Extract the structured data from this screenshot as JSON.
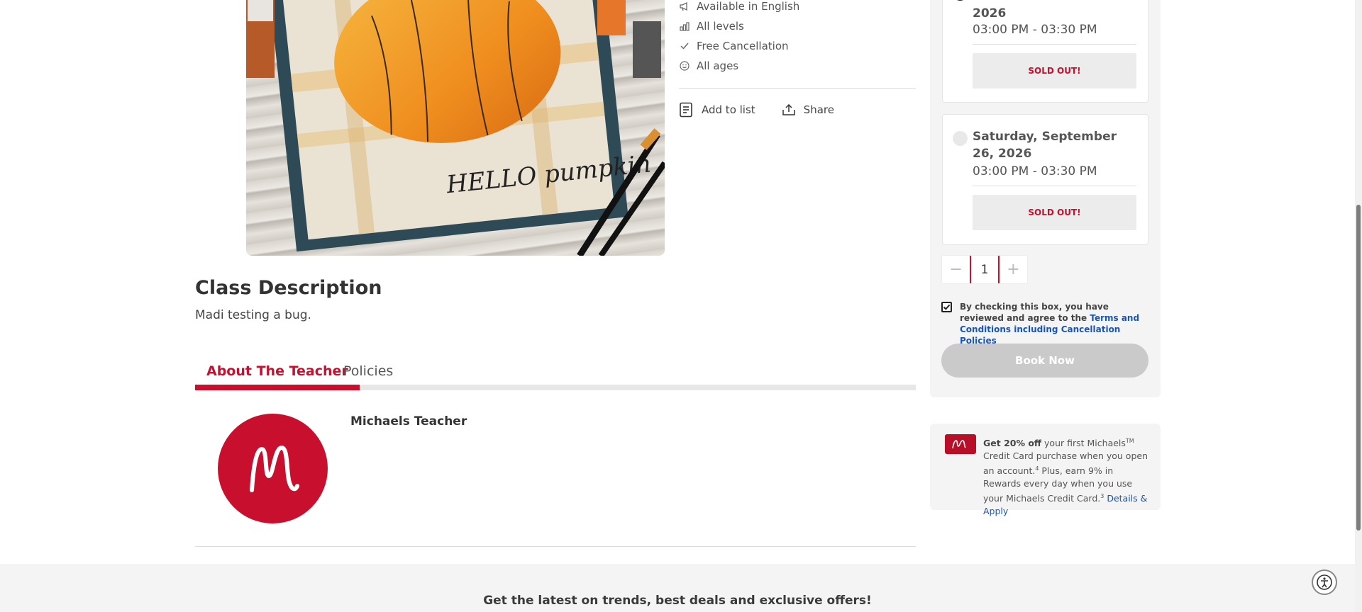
{
  "attributes": [
    {
      "icon": "megaphone-icon",
      "label": "Available in English"
    },
    {
      "icon": "level-bars-icon",
      "label": "All levels"
    },
    {
      "icon": "check-icon",
      "label": "Free Cancellation"
    },
    {
      "icon": "smiley-icon",
      "label": "All ages"
    }
  ],
  "actions": {
    "add_to_list": "Add to list",
    "share": "Share"
  },
  "description": {
    "title": "Class Description",
    "body": "Madi testing a bug."
  },
  "tabs": [
    {
      "label": "About The Teacher",
      "active": true
    },
    {
      "label": "Policies",
      "active": false
    }
  ],
  "teacher": {
    "name": "Michaels Teacher"
  },
  "newsletter": {
    "text": "Get the latest on trends, best deals and exclusive offers!"
  },
  "sessions": [
    {
      "date_partial": "2026",
      "time": "03:00 PM - 03:30 PM",
      "status": "SOLD OUT!",
      "selected": true
    },
    {
      "date": "Saturday, September 26, 2026",
      "time": "03:00 PM - 03:30 PM",
      "status": "SOLD OUT!",
      "selected": false
    }
  ],
  "quantity": {
    "value": "1",
    "minus": "−",
    "plus": "+"
  },
  "agreement": {
    "checked": true,
    "text": "By checking this box, you have reviewed and agree to the ",
    "link": "Terms and Conditions including Cancellation Policies"
  },
  "book_button": "Book Now",
  "credit_promo": {
    "bold": "Get 20% off",
    "text1": " your first Michaels",
    "tm": "TM",
    "text2": " Credit Card purchase when you open an account.",
    "sup1": "4",
    "text3": " Plus, earn 9% in Rewards every day when you use your Michaels Credit Card.",
    "sup2": "3",
    "link": "Details & Apply"
  },
  "image_lettering": "HELLO pumpkin",
  "colors": {
    "brand_red": "#c8102e",
    "link_blue": "#1a55b5",
    "disabled_gray": "#cacaca"
  }
}
